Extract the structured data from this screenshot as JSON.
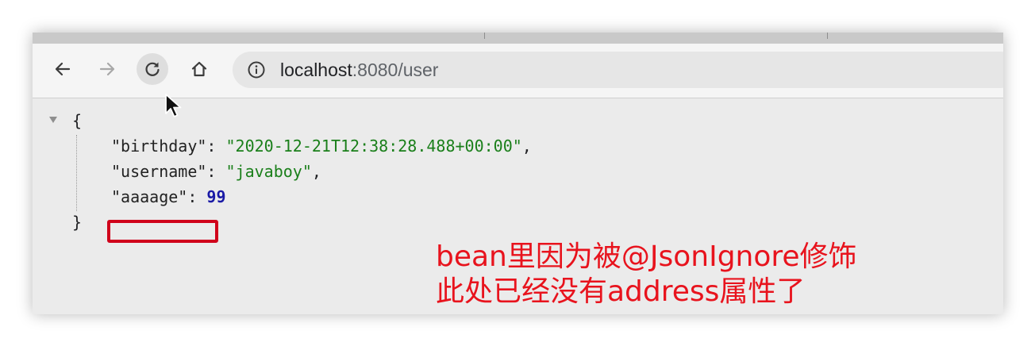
{
  "browser": {
    "url_host": "localhost",
    "url_rest": ":8080/user"
  },
  "json_view": {
    "open_brace": "{",
    "close_brace": "}",
    "entries": [
      {
        "key": "\"birthday\"",
        "sep": ": ",
        "value": "\"2020-12-21T12:38:28.488+00:00\"",
        "trail": ","
      },
      {
        "key": "\"username\"",
        "sep": ": ",
        "value": "\"javaboy\"",
        "trail": ","
      },
      {
        "key": "\"aaaage\"",
        "sep": ": ",
        "value": "99",
        "trail": ""
      }
    ]
  },
  "annotation": {
    "line1": "bean里因为被@JsonIgnore修饰",
    "line2": "此处已经没有address属性了",
    "color": "#e8131d",
    "box_color": "#d0021b"
  },
  "icons": [
    "back-arrow-icon",
    "forward-arrow-icon",
    "reload-icon",
    "home-icon",
    "info-icon",
    "mouse-cursor-icon",
    "collapse-triangle-icon"
  ]
}
